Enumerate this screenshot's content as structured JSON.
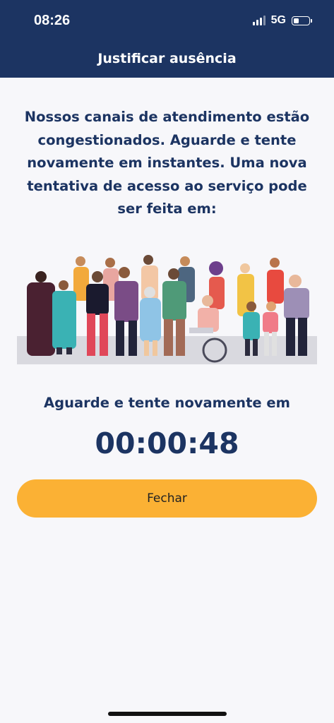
{
  "status_bar": {
    "time": "08:26",
    "network": "5G",
    "battery_level": 0.35
  },
  "header": {
    "title": "Justificar ausência"
  },
  "main": {
    "message": "Nossos canais de atendimento estão congestionados. Aguarde e tente novamente em instantes. Uma nova tentativa de acesso ao serviço pode ser feita em:",
    "wait_label": "Aguarde e tente novamente em",
    "countdown": "00:00:48",
    "close_label": "Fechar"
  },
  "colors": {
    "header_bg": "#1c3462",
    "text_primary": "#1c3462",
    "button_bg": "#fbb134",
    "page_bg": "#f7f7fa"
  },
  "icons": [
    "signal-icon",
    "battery-icon"
  ]
}
